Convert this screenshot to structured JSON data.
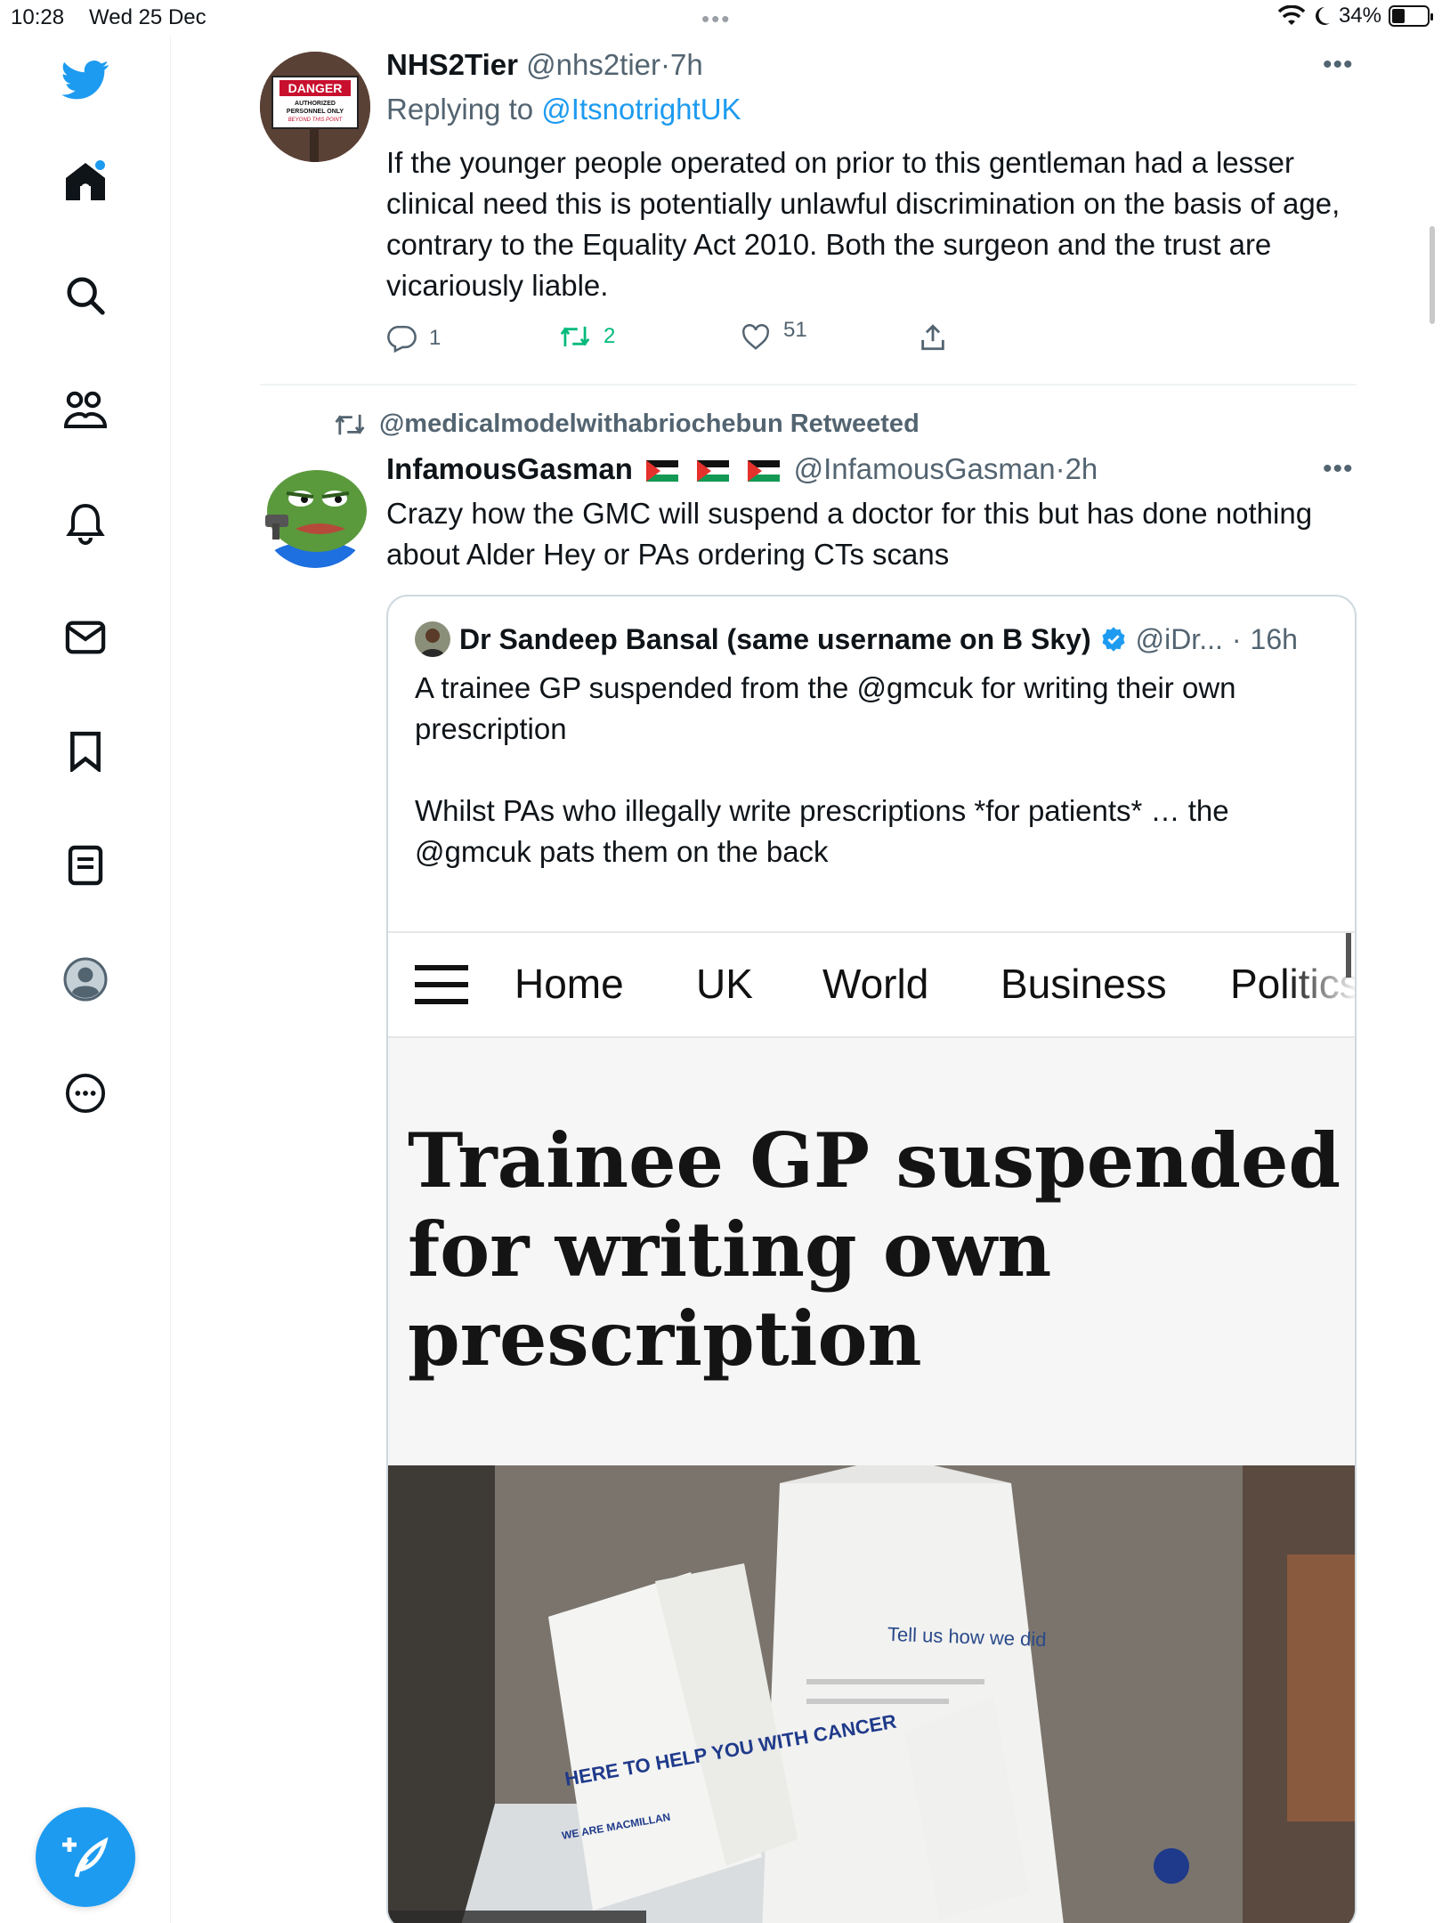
{
  "status_bar": {
    "time": "10:28",
    "date": "Wed 25 Dec",
    "battery": "34%"
  },
  "sidebar": {
    "items": [
      {
        "icon": "twitter-logo-icon"
      },
      {
        "icon": "home-icon"
      },
      {
        "icon": "search-icon"
      },
      {
        "icon": "communities-icon"
      },
      {
        "icon": "notifications-bell-icon"
      },
      {
        "icon": "messages-envelope-icon"
      },
      {
        "icon": "bookmark-icon"
      },
      {
        "icon": "lists-icon"
      },
      {
        "icon": "profile-avatar-icon"
      },
      {
        "icon": "more-circle-icon"
      }
    ],
    "compose_icon": "compose-feather-icon"
  },
  "tweet1": {
    "name": "NHS2Tier",
    "handle": "@nhs2tier",
    "time": "7h",
    "replying_prefix": "Replying to",
    "replying_to": "@ItsnotrightUK",
    "text": "If the younger people operated on prior to this gentleman had a lesser clinical need this is potentially unlawful discrimination on the basis of age, contrary to the Equality Act 2010. Both the surgeon and the trust are vicariously liable.",
    "avatar_sign": {
      "title": "DANGER",
      "line1": "AUTHORIZED",
      "line2": "PERSONNEL ONLY",
      "line3": "BEYOND THIS POINT"
    },
    "replies": "1",
    "retweets": "2",
    "likes": "51"
  },
  "tweet2": {
    "retweeted_by": "@medicalmodelwithabriochebun Retweeted",
    "name": "InfamousGasman",
    "handle": "@InfamousGasman",
    "time": "2h",
    "text": "Crazy how the GMC will suspend a doctor for this but has done nothing about Alder Hey or PAs ordering CTs scans",
    "quote": {
      "name": "Dr Sandeep Bansal (same username on B Sky)",
      "handle": "@iDr...",
      "time": "16h",
      "text1": "A trainee GP suspended from the @gmcuk for writing their own prescription",
      "text2": "Whilst PAs who illegally write prescriptions *for patients* … the @gmcuk pats them on the back",
      "article": {
        "nav": [
          "Home",
          "UK",
          "World",
          "Business",
          "Politics"
        ],
        "headline": "Trainee GP suspended for writing own prescription",
        "photo_text": [
          "Tell us how we did",
          "HERE TO HELP YOU WITH CANCER",
          "WE ARE MACMILLAN"
        ]
      }
    }
  },
  "separator": "·"
}
